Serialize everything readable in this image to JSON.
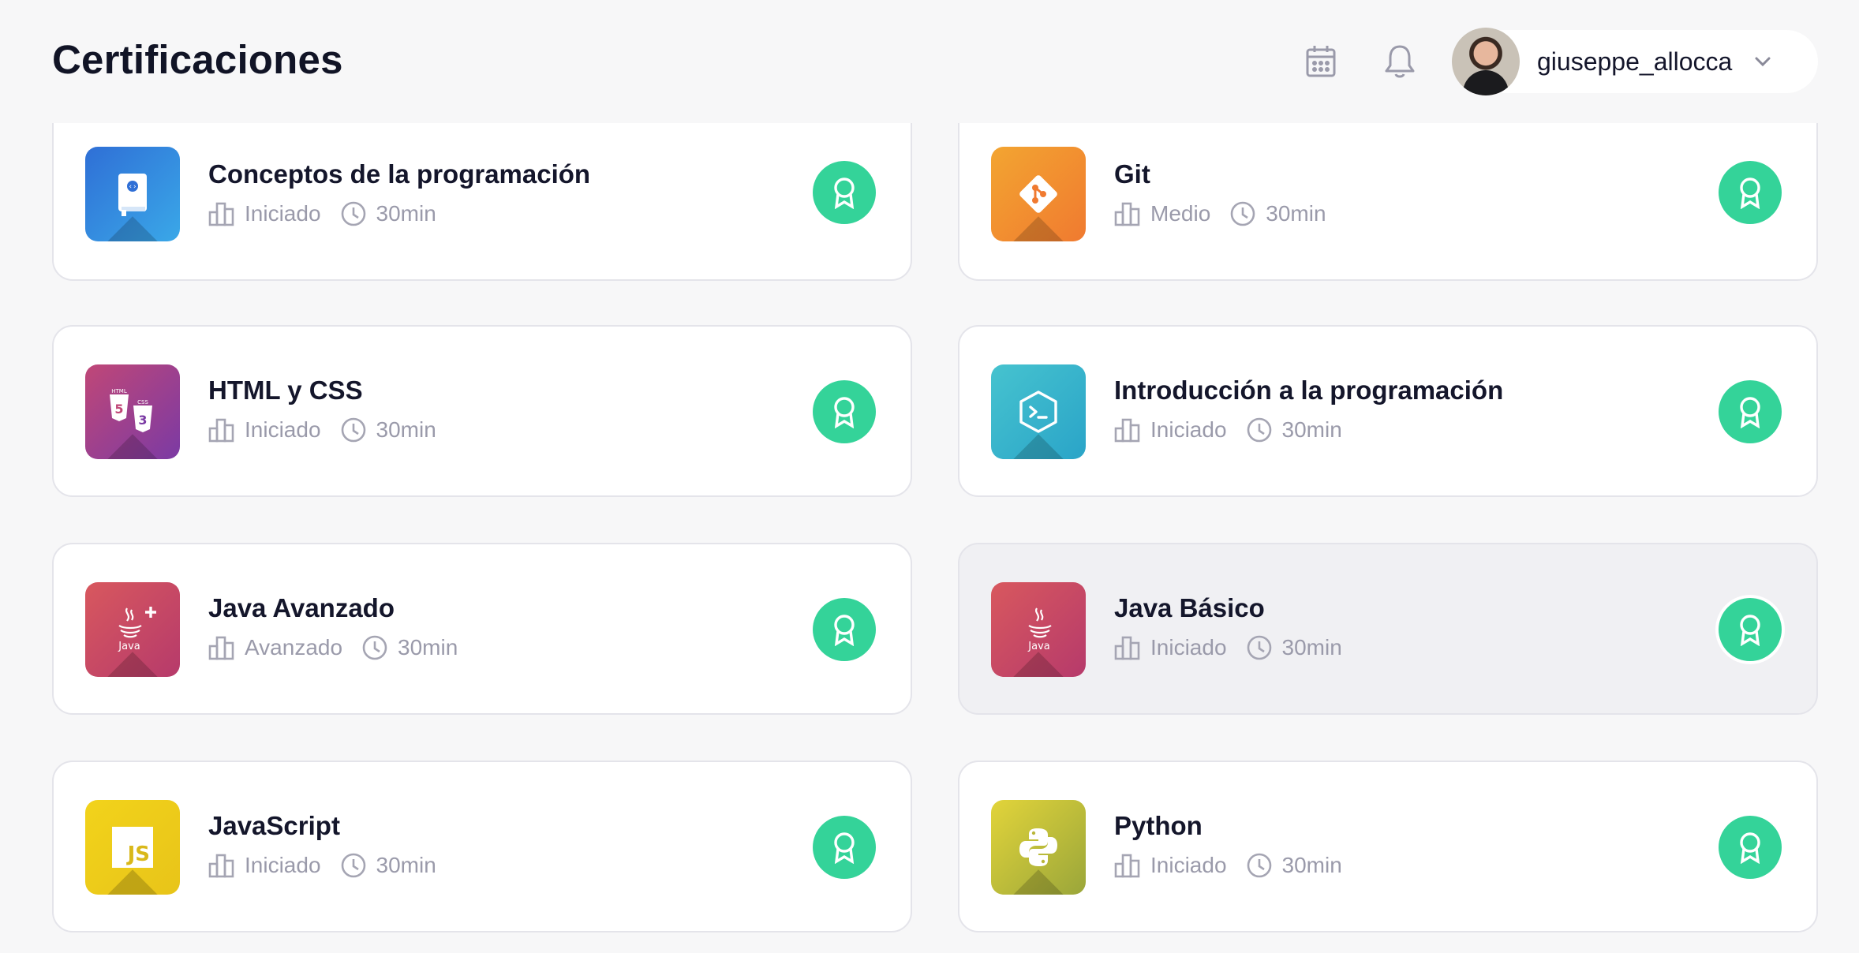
{
  "header": {
    "title": "Certificaciones",
    "calendar_icon": "calendar-icon",
    "bell_icon": "bell-icon",
    "username": "giuseppe_allocca"
  },
  "colors": {
    "accent_green": "#34d399",
    "text_dark": "#14162b",
    "text_muted": "#9a9aaa"
  },
  "certifications": [
    {
      "name": "Conceptos de la programación",
      "level": "Iniciado",
      "duration": "30min",
      "icon": "book-code-icon"
    },
    {
      "name": "Git",
      "level": "Medio",
      "duration": "30min",
      "icon": "git-icon"
    },
    {
      "name": "HTML y CSS",
      "level": "Iniciado",
      "duration": "30min",
      "icon": "html-css-icon"
    },
    {
      "name": "Introducción a la programación",
      "level": "Iniciado",
      "duration": "30min",
      "icon": "terminal-icon"
    },
    {
      "name": "Java Avanzado",
      "level": "Avanzado",
      "duration": "30min",
      "icon": "java-plus-icon"
    },
    {
      "name": "Java Básico",
      "level": "Iniciado",
      "duration": "30min",
      "icon": "java-icon",
      "selected": true
    },
    {
      "name": "JavaScript",
      "level": "Iniciado",
      "duration": "30min",
      "icon": "javascript-icon",
      "badge_text": "JS"
    },
    {
      "name": "Python",
      "level": "Iniciado",
      "duration": "30min",
      "icon": "python-icon"
    }
  ],
  "java_label": "Java",
  "html_label": "HTML",
  "css_label": "CSS"
}
